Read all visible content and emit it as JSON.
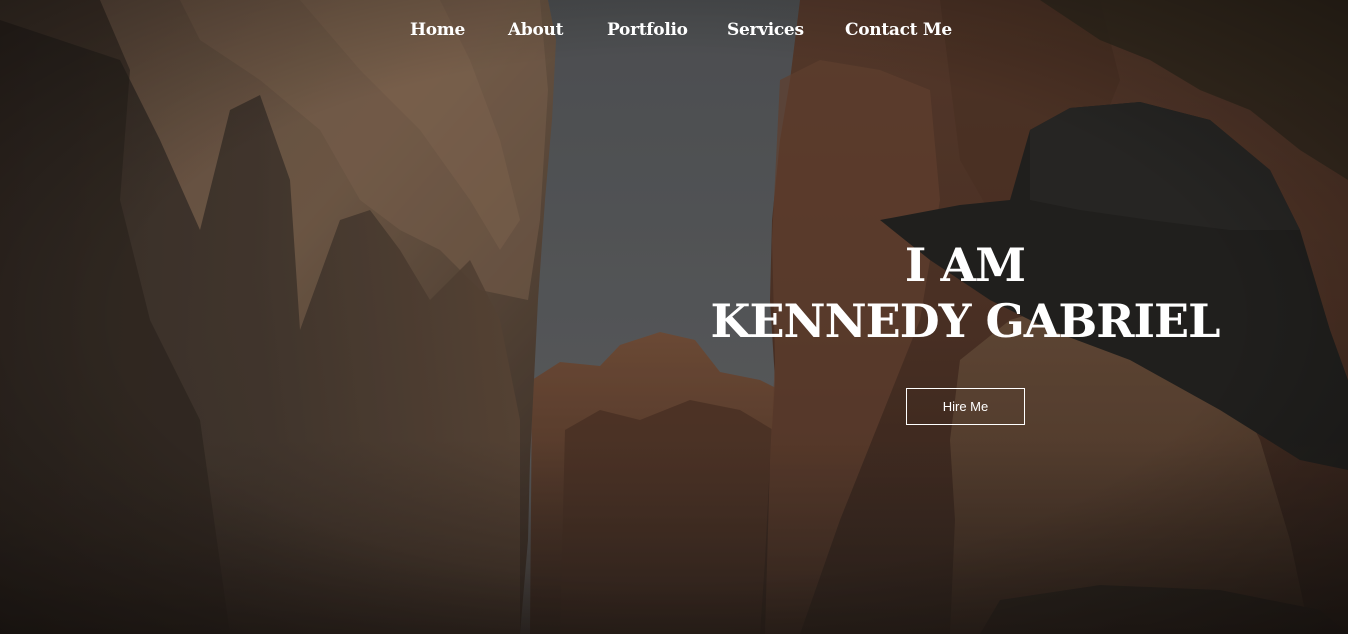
{
  "nav": {
    "items": [
      {
        "label": "Home"
      },
      {
        "label": "About"
      },
      {
        "label": "Portfolio"
      },
      {
        "label": "Services"
      },
      {
        "label": "Contact Me"
      }
    ]
  },
  "hero": {
    "line1": "I AM",
    "line2": "KENNEDY GABRIEL",
    "cta_label": "Hire Me"
  },
  "colors": {
    "text": "#ffffff",
    "sky": "#6a6e74",
    "rock": "#7a5040",
    "overlay": "#1a1410"
  }
}
